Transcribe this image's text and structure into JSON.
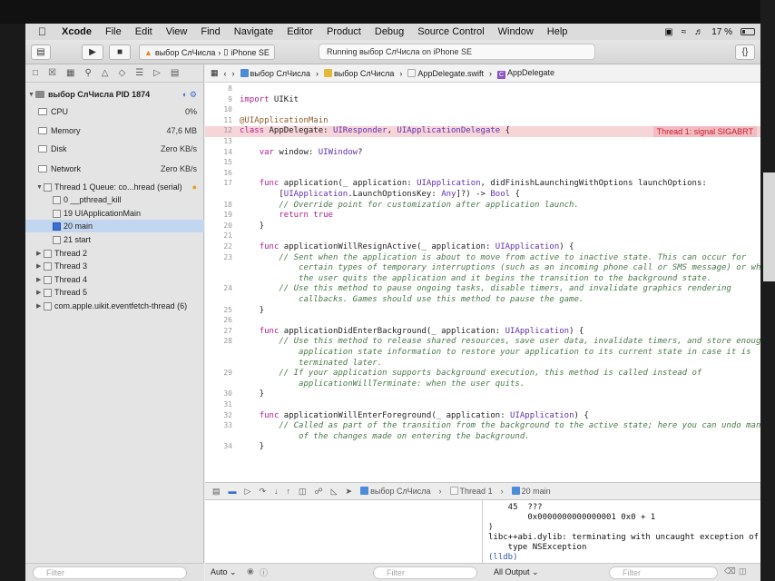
{
  "menubar": {
    "app": "Xcode",
    "items": [
      "File",
      "Edit",
      "View",
      "Find",
      "Navigate",
      "Editor",
      "Product",
      "Debug",
      "Source Control",
      "Window",
      "Help"
    ],
    "battery": "17 %"
  },
  "toolbar": {
    "scheme": "выбор СлЧисла",
    "device": "iPhone SE",
    "status": "Running выбор СлЧисла on iPhone SE"
  },
  "navigator": {
    "process": "выбор СлЧисла PID 1874",
    "gauges": [
      {
        "name": "CPU",
        "value": "0%"
      },
      {
        "name": "Memory",
        "value": "47,6 MB"
      },
      {
        "name": "Disk",
        "value": "Zero KB/s"
      },
      {
        "name": "Network",
        "value": "Zero KB/s"
      }
    ],
    "thread1": "Thread 1 Queue: co...hread (serial)",
    "frames": [
      "0 __pthread_kill",
      "19 UIApplicationMain",
      "20 main",
      "21 start"
    ],
    "threads": [
      "Thread 2",
      "Thread 3",
      "Thread 4",
      "Thread 5",
      "com.apple.uikit.eventfetch-thread (6)"
    ],
    "filter_placeholder": "Filter"
  },
  "jumpbar": {
    "project": "выбор СлЧисла",
    "group": "выбор СлЧисла",
    "file": "AppDelegate.swift",
    "symbol": "AppDelegate"
  },
  "editor": {
    "error": "Thread 1: signal SIGABRT",
    "lines": [
      {
        "n": "8",
        "t": ""
      },
      {
        "n": "9",
        "t": "import UIKit"
      },
      {
        "n": "10",
        "t": ""
      },
      {
        "n": "11",
        "t": "@UIApplicationMain"
      },
      {
        "n": "12",
        "t": "class AppDelegate: UIResponder, UIApplicationDelegate {"
      },
      {
        "n": "13",
        "t": ""
      },
      {
        "n": "14",
        "t": "    var window: UIWindow?"
      },
      {
        "n": "15",
        "t": ""
      },
      {
        "n": "16",
        "t": ""
      },
      {
        "n": "17",
        "t": "    func application(_ application: UIApplication, didFinishLaunchingWithOptions launchOptions:"
      },
      {
        "n": "",
        "t": "        [UIApplication.LaunchOptionsKey: Any]?) -> Bool {"
      },
      {
        "n": "18",
        "t": "        // Override point for customization after application launch."
      },
      {
        "n": "19",
        "t": "        return true"
      },
      {
        "n": "20",
        "t": "    }"
      },
      {
        "n": "21",
        "t": ""
      },
      {
        "n": "22",
        "t": "    func applicationWillResignActive(_ application: UIApplication) {"
      },
      {
        "n": "23",
        "t": "        // Sent when the application is about to move from active to inactive state. This can occur for"
      },
      {
        "n": "",
        "t": "            certain types of temporary interruptions (such as an incoming phone call or SMS message) or when"
      },
      {
        "n": "",
        "t": "            the user quits the application and it begins the transition to the background state."
      },
      {
        "n": "24",
        "t": "        // Use this method to pause ongoing tasks, disable timers, and invalidate graphics rendering"
      },
      {
        "n": "",
        "t": "            callbacks. Games should use this method to pause the game."
      },
      {
        "n": "25",
        "t": "    }"
      },
      {
        "n": "26",
        "t": ""
      },
      {
        "n": "27",
        "t": "    func applicationDidEnterBackground(_ application: UIApplication) {"
      },
      {
        "n": "28",
        "t": "        // Use this method to release shared resources, save user data, invalidate timers, and store enough"
      },
      {
        "n": "",
        "t": "            application state information to restore your application to its current state in case it is"
      },
      {
        "n": "",
        "t": "            terminated later."
      },
      {
        "n": "29",
        "t": "        // If your application supports background execution, this method is called instead of"
      },
      {
        "n": "",
        "t": "            applicationWillTerminate: when the user quits."
      },
      {
        "n": "30",
        "t": "    }"
      },
      {
        "n": "31",
        "t": ""
      },
      {
        "n": "32",
        "t": "    func applicationWillEnterForeground(_ application: UIApplication) {"
      },
      {
        "n": "33",
        "t": "        // Called as part of the transition from the background to the active state; here you can undo many"
      },
      {
        "n": "",
        "t": "            of the changes made on entering the background."
      },
      {
        "n": "34",
        "t": "    }"
      }
    ]
  },
  "debugbar": {
    "project": "выбор СлЧисла",
    "thread": "Thread 1",
    "frame": "20 main"
  },
  "console": {
    "lines": [
      "    45  ???",
      "        0x0000000000000001 0x0 + 1",
      ")",
      "libc++abi.dylib: terminating with uncaught exception of",
      "    type NSException",
      "(lldb)"
    ]
  },
  "bottom": {
    "auto": "Auto",
    "filter": "Filter",
    "output": "All Output"
  }
}
